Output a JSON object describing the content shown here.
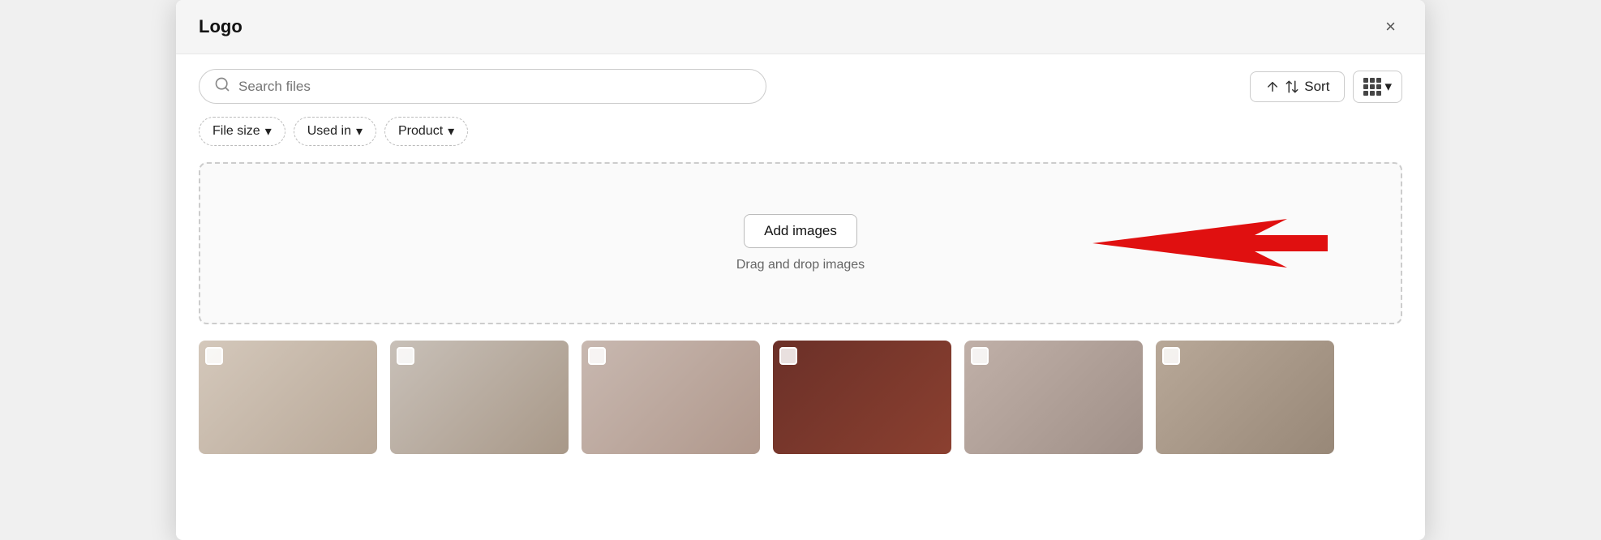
{
  "modal": {
    "title": "Logo"
  },
  "header": {
    "close_label": "×"
  },
  "search": {
    "placeholder": "Search files",
    "value": ""
  },
  "toolbar": {
    "sort_label": "Sort",
    "grid_chevron": "▾"
  },
  "filters": [
    {
      "id": "file-size",
      "label": "File size",
      "chevron": "▾"
    },
    {
      "id": "used-in",
      "label": "Used in",
      "chevron": "▾"
    },
    {
      "id": "product",
      "label": "Product",
      "chevron": "▾"
    }
  ],
  "dropzone": {
    "add_images_label": "Add images",
    "drag_drop_label": "Drag and drop images"
  },
  "thumbnails": [
    {
      "id": 1,
      "class": "thumb-1"
    },
    {
      "id": 2,
      "class": "thumb-2"
    },
    {
      "id": 3,
      "class": "thumb-3"
    },
    {
      "id": 4,
      "class": "thumb-4"
    },
    {
      "id": 5,
      "class": "thumb-5"
    },
    {
      "id": 6,
      "class": "thumb-6"
    }
  ]
}
